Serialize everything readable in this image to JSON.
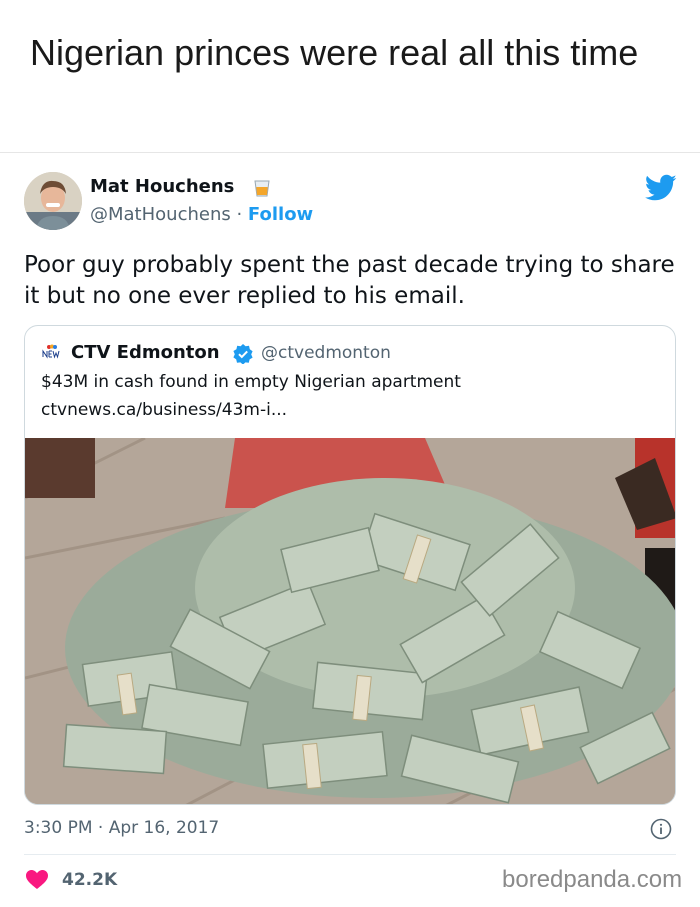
{
  "headline": "Nigerian princes were real all this time",
  "tweet": {
    "author_name": "Mat Houchens",
    "name_emoji": "tumbler-glass-emoji",
    "handle": "@MatHouchens",
    "separator": " · ",
    "follow_label": "Follow",
    "text": "Poor guy probably spent the past decade trying to share it but no one ever replied to his email.",
    "timestamp": "3:30 PM · Apr 16, 2017",
    "likes": "42.2K"
  },
  "quoted_card": {
    "source_name": "CTV Edmonton",
    "source_handle": "@ctvedmonton",
    "title": "$43M in cash found in empty Nigerian apartment",
    "url": "ctvnews.ca/business/43m-i...",
    "image_subject": "pile-of-100-dollar-bill-bundles-photo"
  },
  "watermark": "boredpanda.com",
  "colors": {
    "twitter_blue": "#1d9bf0",
    "like_pink": "#f91880",
    "muted_text": "#536471"
  }
}
